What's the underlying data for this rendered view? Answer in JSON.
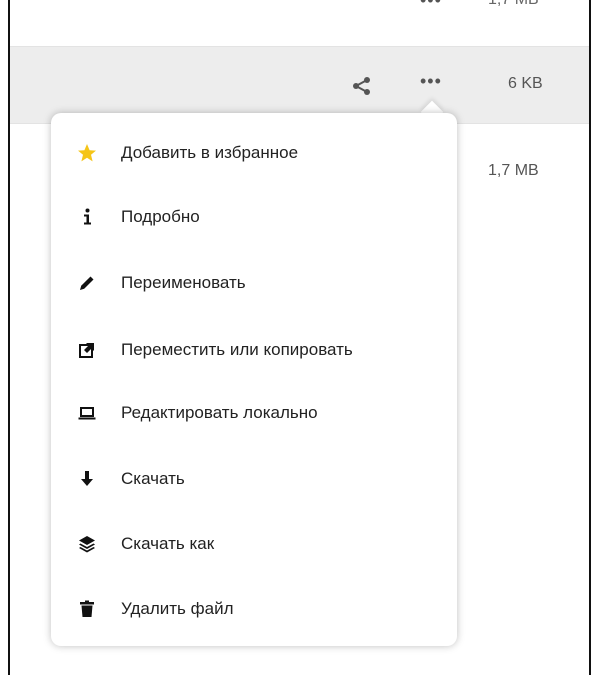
{
  "files": {
    "top_row": {
      "size": "1,7 MB",
      "menu_label": "•••"
    },
    "selected_row": {
      "size": "6 KB",
      "menu_label": "•••"
    },
    "third_row": {
      "size": "1,7 MB"
    }
  },
  "colors": {
    "favorite_star": "#f5c518",
    "selected_row_bg": "#ededed"
  },
  "context_menu": {
    "items": [
      {
        "label": "Добавить в избранное",
        "icon": "star-icon"
      },
      {
        "label": "Подробно",
        "icon": "info-icon"
      },
      {
        "label": "Переименовать",
        "icon": "pencil-icon"
      },
      {
        "label": "Переместить или копировать",
        "icon": "external-link-icon"
      },
      {
        "label": "Редактировать локально",
        "icon": "laptop-icon"
      },
      {
        "label": "Скачать",
        "icon": "download-arrow-icon"
      },
      {
        "label": "Скачать как",
        "icon": "layers-icon"
      },
      {
        "label": "Удалить файл",
        "icon": "trash-icon"
      }
    ]
  }
}
